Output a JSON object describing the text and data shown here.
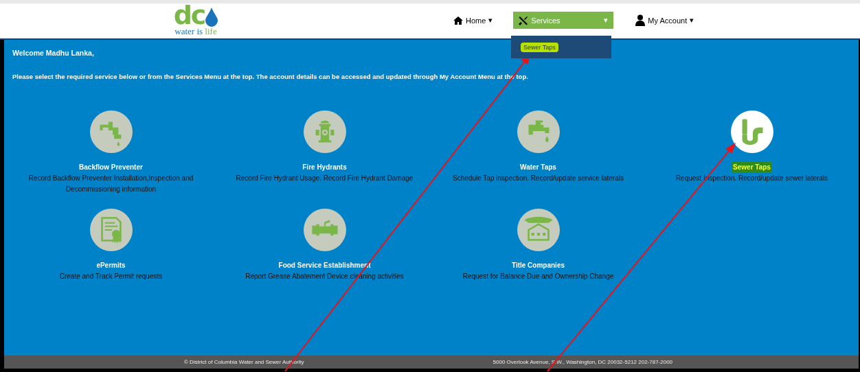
{
  "header": {
    "logo": {
      "letters": "dc",
      "tagline_main": "water is ",
      "tagline_accent": "life"
    },
    "nav": [
      {
        "kind": "home",
        "label": "Home",
        "selected": false,
        "caret": "▾"
      },
      {
        "kind": "services",
        "label": "Services",
        "selected": true,
        "caret": "▾"
      },
      {
        "kind": "account",
        "label": "My Account",
        "selected": false,
        "caret": "▾"
      }
    ],
    "services_menu": {
      "expanded": true,
      "items": [
        {
          "label": "Sewer Taps",
          "highlighted": true
        }
      ]
    }
  },
  "welcome": "Welcome Madhu Lanka,",
  "instructions": "Please select the required service below or from the Services Menu at the top. The account details can be accessed and updated through My Account Menu at the top.",
  "services": [
    {
      "kind": "backflow",
      "title": "Backflow Preventer",
      "description": "Record Backflow Preventer Installation,Inspection and Decommissioning information",
      "highlighted": false
    },
    {
      "kind": "hydrant",
      "title": "Fire Hydrants",
      "description": "Record Fire Hydrant Usage. Record Fire Hydrant Damage",
      "highlighted": false
    },
    {
      "kind": "tap",
      "title": "Water Taps",
      "description": "Schedule Tap inspection. Record/update service laterals",
      "highlighted": false
    },
    {
      "kind": "sewer",
      "title": "Sewer Taps",
      "description": "Request Inspection. Record/update sewer laterals",
      "highlighted": true
    },
    {
      "kind": "permit",
      "title": "ePermits",
      "description": "Create and Track Permit requests",
      "highlighted": false
    },
    {
      "kind": "valve",
      "title": "Food Service Establishment",
      "description": "Report Grease Abatement Device cleaning activities",
      "highlighted": false
    },
    {
      "kind": "title",
      "title": "Title Companies",
      "description": "Request for Balance Due and Ownership Change",
      "highlighted": false
    }
  ],
  "footer": {
    "copyright": "© District of Columbia Water and Sewer Authority",
    "address": "5000 Overlook Avenue, S.W., Washington, DC 20032-5212 202-787-2000"
  },
  "annotations": [
    {
      "kind": "arrow"
    },
    {
      "kind": "arrow"
    }
  ]
}
